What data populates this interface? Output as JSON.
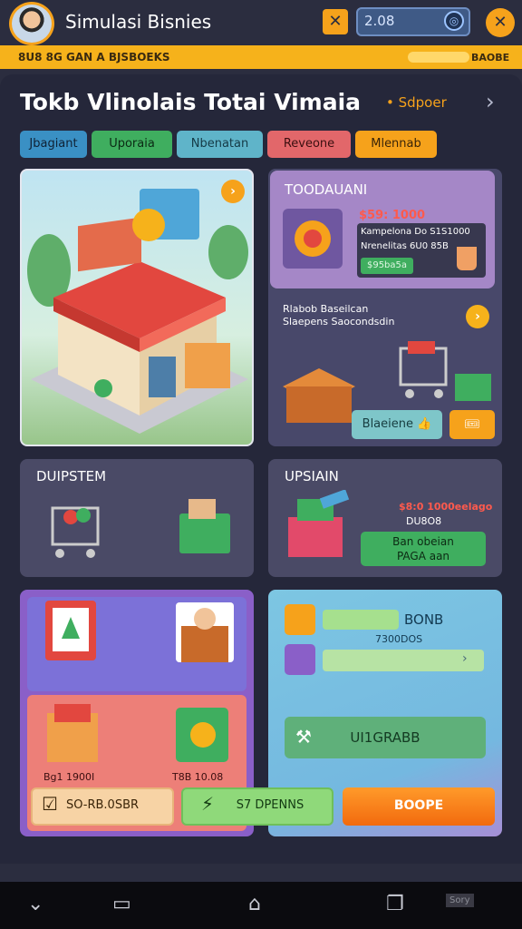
{
  "header": {
    "title": "Simulasi Bisnies",
    "coins": "2.08",
    "x_label": "✕",
    "coin_icon": "◎",
    "close_label": "✕"
  },
  "strip": {
    "text": "8U8 8G  GAN A BJSBOEKS",
    "right": "BAOBE"
  },
  "store": {
    "title": "Tokb Vlinolais Totai Vimaia",
    "tag": "• Sdpoer",
    "chevron": "›"
  },
  "tabs": [
    "Jbagiant",
    "Uporaia",
    "Nbenatan",
    "Reveone",
    "Mlennab"
  ],
  "shop": {
    "badge": "›"
  },
  "right_top": {
    "title": "TOODAUANI",
    "price": "$59: 1000",
    "info1": "Kampelona Do S1S1000",
    "info2": "Nrenelitas 6U0 85B",
    "green": "$95ba5a",
    "desc1": "Rlabob Baseilcan",
    "desc2": "Slaepens Saocondsdin",
    "badge": "›",
    "button": "Blaeiene",
    "button_icon": "👍",
    "button2": "🎟"
  },
  "mid_left": {
    "title": "DUIPSTEM"
  },
  "mid_right": {
    "title": "UPSIAIN",
    "price": "$8:0 1000eelago",
    "sub": "DU8O8",
    "green1": "Ban obeian",
    "green2": "PAGA aan"
  },
  "bottom_left": {
    "price1": "Bg1 1900I",
    "price2": "T8B 10.08"
  },
  "bottom_right": {
    "bonus": "BONB",
    "sub": "7300DOS",
    "arrow": "›",
    "upgrade": "UI1GRABB",
    "upgrade_icon": "⚒"
  },
  "actions": {
    "btn1": "SO-RB.0SBR",
    "btn1_icon": "☑",
    "btn2": "S7 DPENNS",
    "btn2_icon": "⚡",
    "btn3": "BOOPE"
  },
  "nav": {
    "back": "⌄",
    "recents": "▭",
    "home": "⌂",
    "windows": "❐",
    "watermark": "Sory"
  },
  "colors": {
    "accent": "#f6a21b",
    "background": "#2b2d3f",
    "green": "#3fae5f",
    "red": "#e2676a"
  }
}
